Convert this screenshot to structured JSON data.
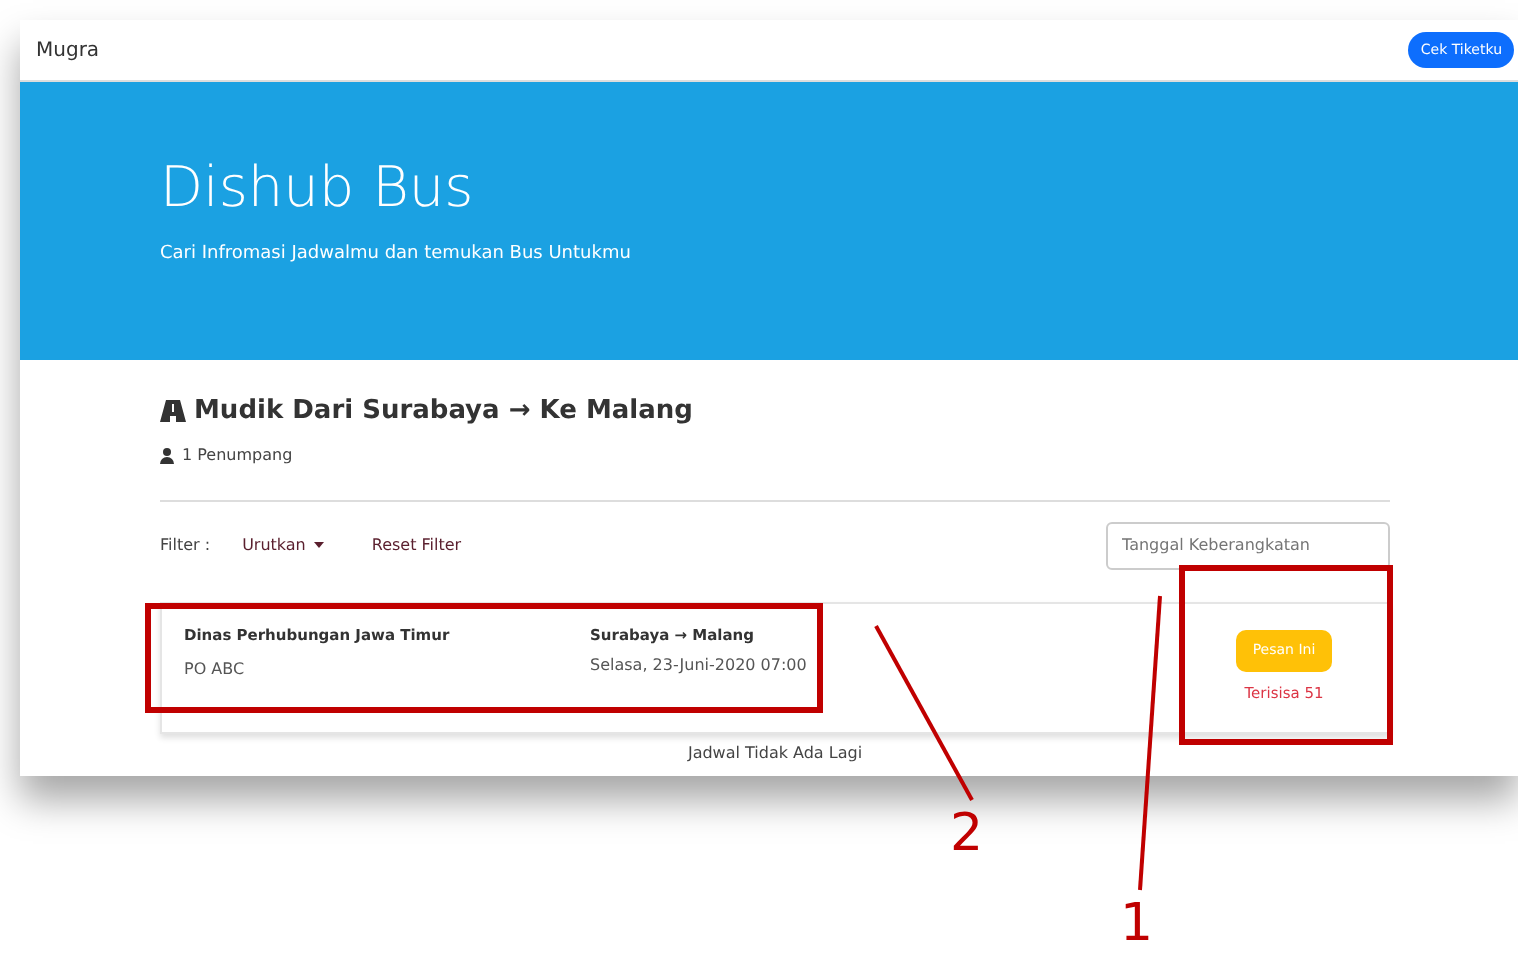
{
  "navbar": {
    "brand": "Mugra",
    "button": "Cek Tiketku"
  },
  "hero": {
    "title": "Dishub Bus",
    "subtitle": "Cari Infromasi Jadwalmu dan temukan Bus Untukmu"
  },
  "trip": {
    "title": "Mudik Dari Surabaya → Ke Malang",
    "passengers": "1 Penumpang"
  },
  "filter": {
    "label": "Filter :",
    "sort": "Urutkan",
    "reset": "Reset Filter",
    "date_placeholder": "Tanggal Keberangkatan"
  },
  "schedules": [
    {
      "operator": "Dinas Perhubungan Jawa Timur",
      "company": "PO ABC",
      "route": "Surabaya → Malang",
      "departure": "Selasa, 23-Juni-2020 07:00",
      "button": "Pesan Ini",
      "remaining": "Terisisa 51"
    }
  ],
  "footer_note": "Jadwal Tidak Ada Lagi",
  "annotations": [
    {
      "label": "2"
    },
    {
      "label": "1"
    }
  ]
}
